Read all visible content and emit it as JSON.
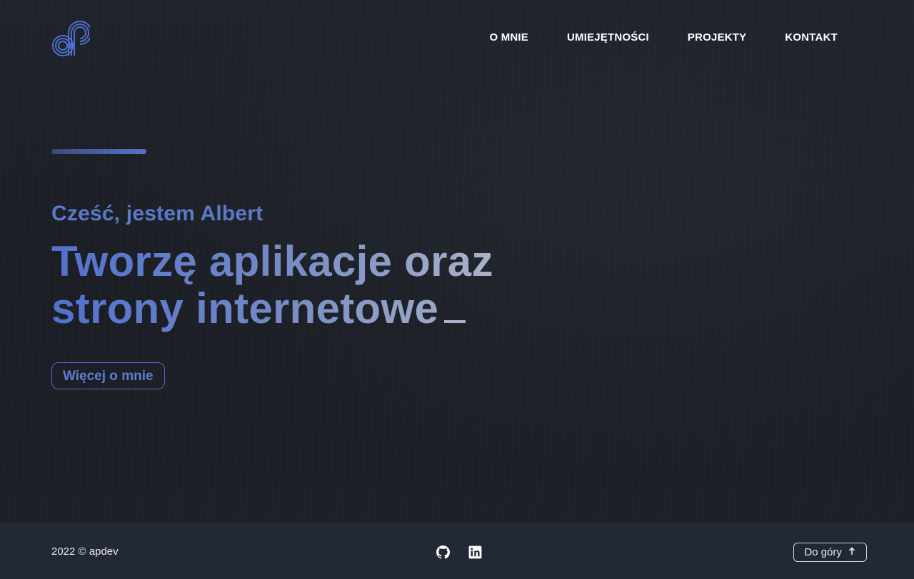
{
  "header": {
    "logo_icon": "ap-logo-icon",
    "nav": [
      {
        "label": "O MNIE"
      },
      {
        "label": "UMIEJĘTNOŚCI"
      },
      {
        "label": "PROJEKTY"
      },
      {
        "label": "KONTAKT"
      }
    ]
  },
  "hero": {
    "greeting": "Cześć, jestem Albert",
    "headline_line1": "Tworzę aplikacje oraz",
    "headline_line2": "strony internetowe",
    "cta_label": "Więcej o mnie"
  },
  "footer": {
    "copyright": "2022 © apdev",
    "social": [
      {
        "icon": "github-icon"
      },
      {
        "icon": "linkedin-icon"
      }
    ],
    "back_to_top_label": "Do góry",
    "back_to_top_icon": "arrow-up-icon"
  },
  "colors": {
    "accent": "#5573c9",
    "background": "#1c1f26",
    "footer_background": "#222834"
  }
}
